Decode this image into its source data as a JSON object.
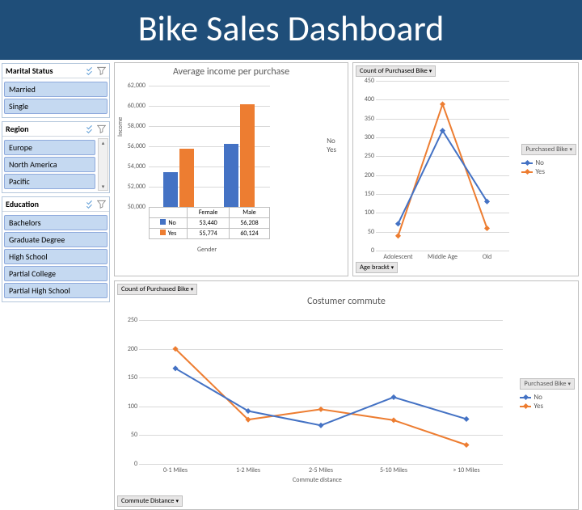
{
  "banner": {
    "title": "Bike Sales Dashboard"
  },
  "slicers": {
    "marital": {
      "title": "Marital Status",
      "items": [
        "Married",
        "Single"
      ]
    },
    "region": {
      "title": "Region",
      "items": [
        "Europe",
        "North America",
        "Pacific"
      ]
    },
    "education": {
      "title": "Education",
      "items": [
        "Bachelors",
        "Graduate Degree",
        "High School",
        "Partial College",
        "Partial High School"
      ]
    }
  },
  "chart_data": [
    {
      "id": "income",
      "type": "bar",
      "title": "Average income per purchase",
      "xlabel": "Gender",
      "ylabel": "Income",
      "categories": [
        "Female",
        "Male"
      ],
      "series": [
        {
          "name": "No",
          "color": "#4472c4",
          "values": [
            53440,
            56208
          ]
        },
        {
          "name": "Yes",
          "color": "#ed7d31",
          "values": [
            55774,
            60124
          ]
        }
      ],
      "yticks": [
        50000,
        52000,
        54000,
        56000,
        58000,
        60000,
        62000
      ],
      "ytick_labels": [
        "50,000",
        "52,000",
        "54,000",
        "56,000",
        "58,000",
        "60,000",
        "62,000"
      ],
      "ylim": [
        50000,
        62000
      ],
      "legend_extra": [
        "No",
        "Yes"
      ],
      "table_rows": [
        {
          "swatch": "#4472c4",
          "label": "No",
          "vals": [
            "53,440",
            "56,208"
          ]
        },
        {
          "swatch": "#ed7d31",
          "label": "Yes",
          "vals": [
            "55,774",
            "60,124"
          ]
        }
      ]
    },
    {
      "id": "age",
      "type": "line",
      "pill_top": "Count of Purchased Bike",
      "pill_bottom": "Age brackt",
      "legend_title": "Purchased Bike",
      "categories": [
        "Adolescent",
        "Middle Age",
        "Old"
      ],
      "series": [
        {
          "name": "No",
          "color": "#4472c4",
          "values": [
            71,
            318,
            130
          ]
        },
        {
          "name": "Yes",
          "color": "#ed7d31",
          "values": [
            39,
            388,
            59
          ]
        }
      ],
      "yticks": [
        0,
        50,
        100,
        150,
        200,
        250,
        300,
        350,
        400,
        450
      ],
      "ylim": [
        0,
        450
      ]
    },
    {
      "id": "commute",
      "type": "line",
      "title": "Costumer commute",
      "pill_top": "Count of Purchased Bike",
      "pill_bottom": "Commute Distance",
      "legend_title": "Purchased Bike",
      "xlabel": "Commute distance",
      "categories": [
        "0-1 Miles",
        "1-2 Miles",
        "2-5 Miles",
        "5-10 Miles",
        "> 10 Miles"
      ],
      "series": [
        {
          "name": "No",
          "color": "#4472c4",
          "values": [
            166,
            92,
            67,
            116,
            78
          ]
        },
        {
          "name": "Yes",
          "color": "#ed7d31",
          "values": [
            200,
            77,
            95,
            76,
            33
          ]
        }
      ],
      "yticks": [
        0,
        50,
        100,
        150,
        200,
        250
      ],
      "ylim": [
        0,
        250
      ]
    }
  ]
}
